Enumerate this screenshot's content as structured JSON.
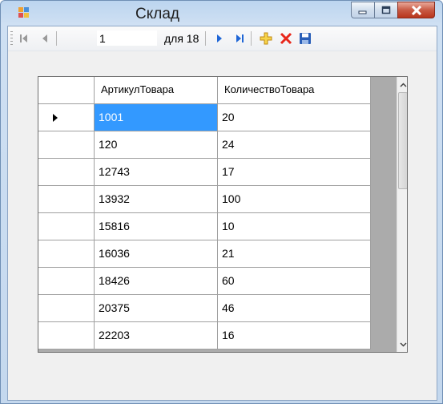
{
  "window": {
    "title": "Склад",
    "icon": "app-icon",
    "caption_buttons": [
      "minimize-icon",
      "maximize-icon",
      "close-icon"
    ]
  },
  "navigator": {
    "position": "1",
    "count_label": "для 18",
    "buttons": [
      "move-first-icon",
      "move-previous-icon",
      "move-next-icon",
      "move-last-icon",
      "add-new-icon",
      "delete-icon",
      "save-icon"
    ]
  },
  "grid": {
    "columns": [
      "АртикулТовара",
      "КоличествоТовара"
    ],
    "rows": [
      {
        "article": "1001",
        "quantity": "20"
      },
      {
        "article": "120",
        "quantity": "24"
      },
      {
        "article": "12743",
        "quantity": "17"
      },
      {
        "article": "13932",
        "quantity": "100"
      },
      {
        "article": "15816",
        "quantity": "10"
      },
      {
        "article": "16036",
        "quantity": "21"
      },
      {
        "article": "18426",
        "quantity": "60"
      },
      {
        "article": "20375",
        "quantity": "46"
      },
      {
        "article": "22203",
        "quantity": "16"
      }
    ],
    "selected_row": 0
  },
  "colors": {
    "selection": "#3399ff",
    "grid_background": "#ababab",
    "close_button": "#c85a44"
  }
}
